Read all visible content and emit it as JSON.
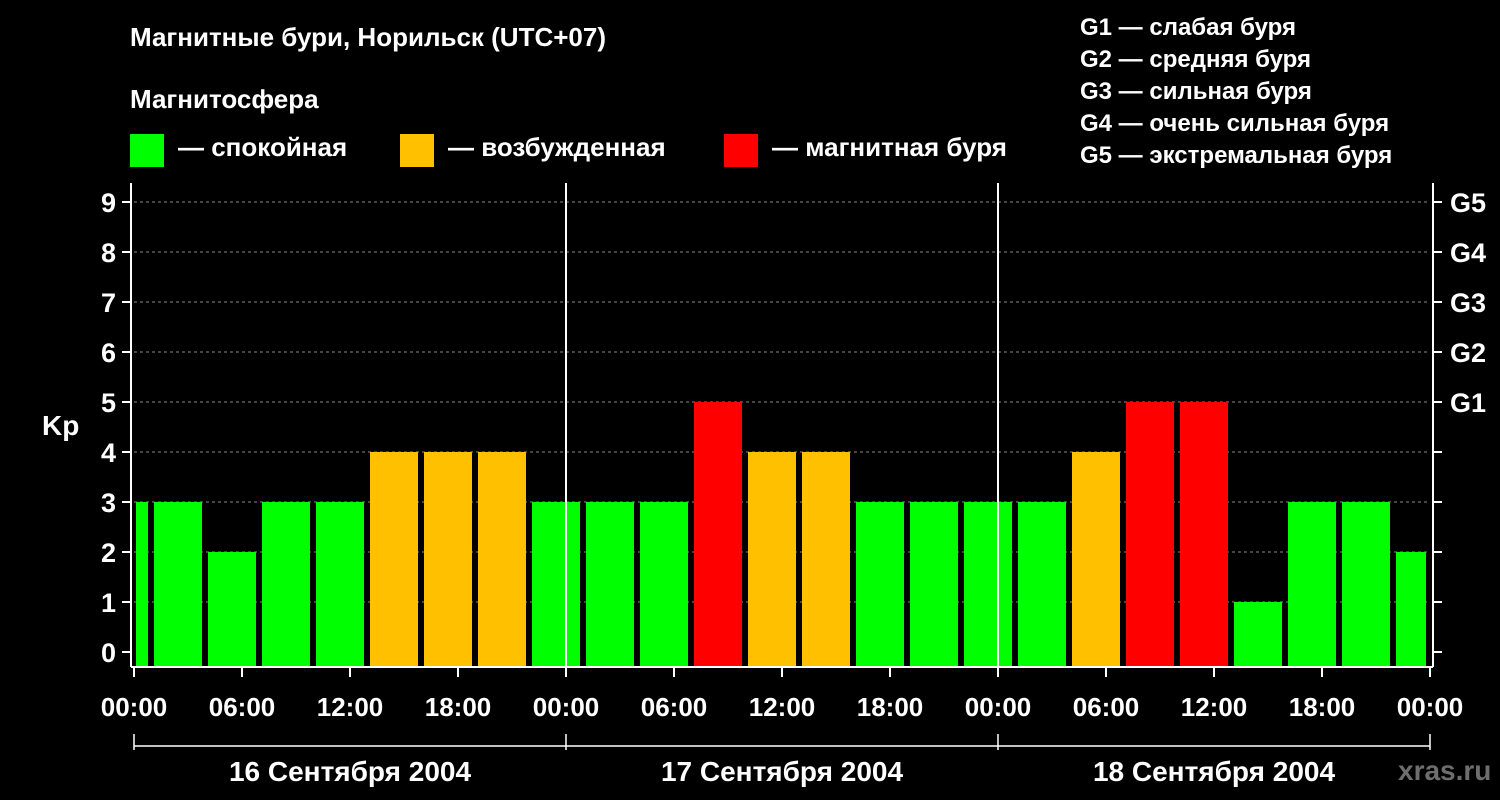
{
  "title": "Магнитные бури, Норильск (UTC+07)",
  "magnetosphere": {
    "heading": "Магнитосфера",
    "items": [
      {
        "label": "— спокойная",
        "color": "#00ff00"
      },
      {
        "label": "— возбужденная",
        "color": "#ffc000"
      },
      {
        "label": "— магнитная буря",
        "color": "#ff0000"
      }
    ]
  },
  "g_legend": [
    "G1 — слабая буря",
    "G2 — средняя буря",
    "G3 — сильная буря",
    "G4 — очень сильная буря",
    "G5 — экстремальная буря"
  ],
  "watermark": "xras.ru",
  "chart_data": {
    "type": "bar",
    "ylabel": "Kp",
    "ylim": [
      0,
      9
    ],
    "yticks": [
      0,
      1,
      2,
      3,
      4,
      5,
      6,
      7,
      8,
      9
    ],
    "right_ticks": [
      {
        "kp": 5,
        "label": "G1"
      },
      {
        "kp": 6,
        "label": "G2"
      },
      {
        "kp": 7,
        "label": "G3"
      },
      {
        "kp": 8,
        "label": "G4"
      },
      {
        "kp": 9,
        "label": "G5"
      }
    ],
    "grid": "dashed horizontal",
    "x_hours_total": 72,
    "x_tick_labels": [
      "00:00",
      "06:00",
      "12:00",
      "18:00",
      "00:00",
      "06:00",
      "12:00",
      "18:00",
      "00:00",
      "06:00",
      "12:00",
      "18:00",
      "00:00"
    ],
    "days": [
      "16 Сентября 2004",
      "17 Сентября 2004",
      "18 Сентября 2004"
    ],
    "levels": {
      "quiet": "#00ff00",
      "active": "#ffc000",
      "storm": "#ff0000"
    },
    "bars": [
      {
        "start_hour": 0,
        "end_hour": 1,
        "kp": 3
      },
      {
        "start_hour": 1,
        "end_hour": 4,
        "kp": 3
      },
      {
        "start_hour": 4,
        "end_hour": 7,
        "kp": 2
      },
      {
        "start_hour": 7,
        "end_hour": 10,
        "kp": 3
      },
      {
        "start_hour": 10,
        "end_hour": 13,
        "kp": 3
      },
      {
        "start_hour": 13,
        "end_hour": 16,
        "kp": 4
      },
      {
        "start_hour": 16,
        "end_hour": 19,
        "kp": 4
      },
      {
        "start_hour": 19,
        "end_hour": 22,
        "kp": 4
      },
      {
        "start_hour": 22,
        "end_hour": 25,
        "kp": 3
      },
      {
        "start_hour": 25,
        "end_hour": 28,
        "kp": 3
      },
      {
        "start_hour": 28,
        "end_hour": 31,
        "kp": 3
      },
      {
        "start_hour": 31,
        "end_hour": 34,
        "kp": 5
      },
      {
        "start_hour": 34,
        "end_hour": 37,
        "kp": 4
      },
      {
        "start_hour": 37,
        "end_hour": 40,
        "kp": 4
      },
      {
        "start_hour": 40,
        "end_hour": 43,
        "kp": 3
      },
      {
        "start_hour": 43,
        "end_hour": 46,
        "kp": 3
      },
      {
        "start_hour": 46,
        "end_hour": 49,
        "kp": 3
      },
      {
        "start_hour": 49,
        "end_hour": 52,
        "kp": 3
      },
      {
        "start_hour": 52,
        "end_hour": 55,
        "kp": 4
      },
      {
        "start_hour": 55,
        "end_hour": 58,
        "kp": 5
      },
      {
        "start_hour": 58,
        "end_hour": 61,
        "kp": 5
      },
      {
        "start_hour": 61,
        "end_hour": 64,
        "kp": 1
      },
      {
        "start_hour": 64,
        "end_hour": 67,
        "kp": 3
      },
      {
        "start_hour": 67,
        "end_hour": 70,
        "kp": 3
      },
      {
        "start_hour": 70,
        "end_hour": 72,
        "kp": 2
      }
    ]
  }
}
